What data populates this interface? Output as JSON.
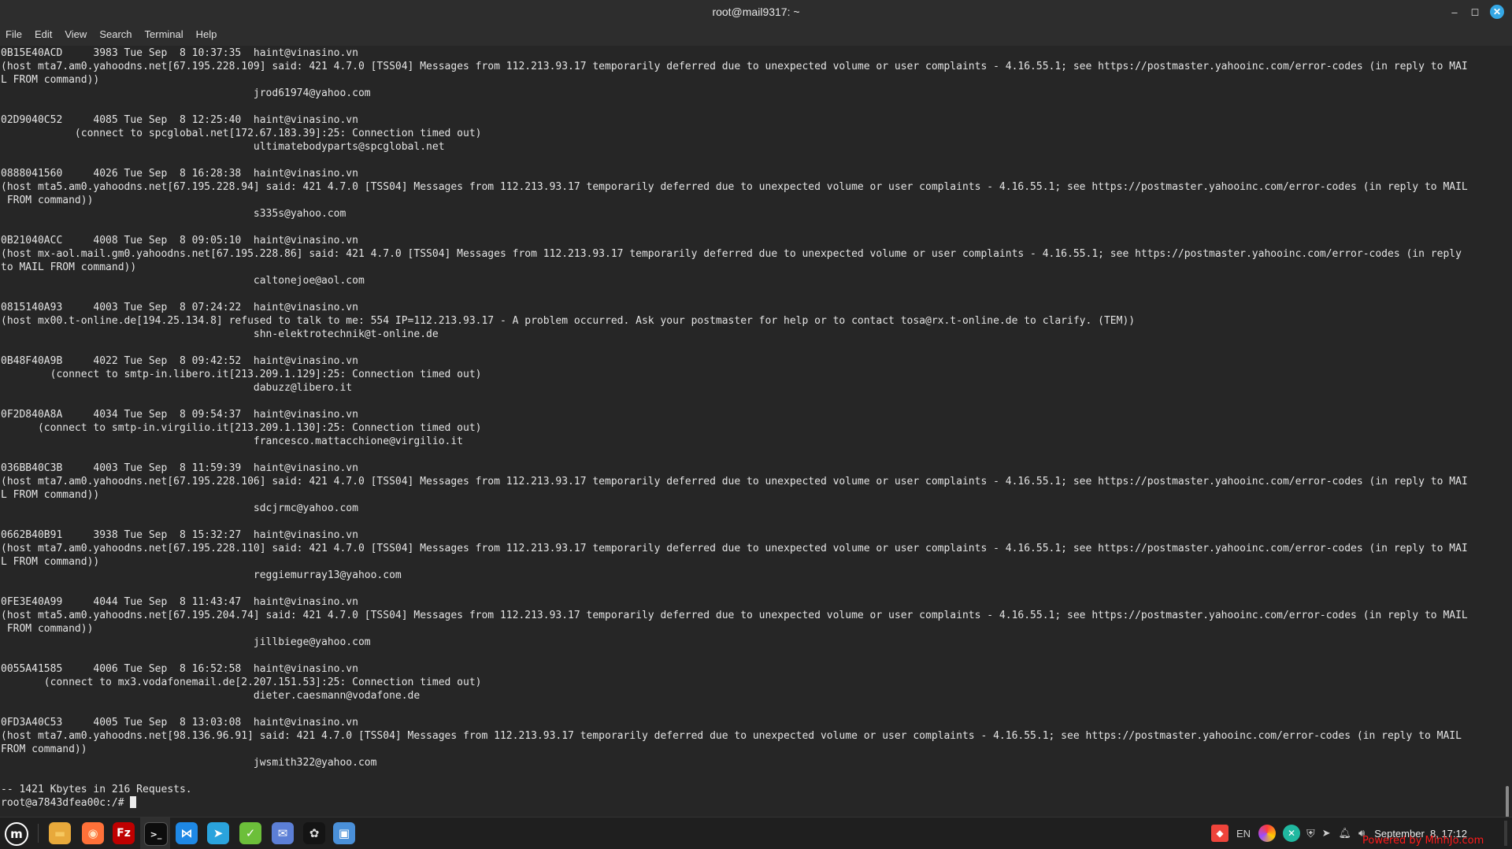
{
  "window": {
    "title": "root@mail9317: ~",
    "minimize_glyph": "–",
    "maximize_glyph": "◻",
    "close_glyph": "✕"
  },
  "menubar": {
    "items": [
      "File",
      "Edit",
      "View",
      "Search",
      "Terminal",
      "Help"
    ]
  },
  "terminal": {
    "lines": [
      "0B15E40ACD     3983 Tue Sep  8 10:37:35  haint@vinasino.vn",
      "(host mta7.am0.yahoodns.net[67.195.228.109] said: 421 4.7.0 [TSS04] Messages from 112.213.93.17 temporarily deferred due to unexpected volume or user complaints - 4.16.55.1; see https://postmaster.yahooinc.com/error-codes (in reply to MAI",
      "L FROM command))",
      "                                         jrod61974@yahoo.com",
      "",
      "02D9040C52     4085 Tue Sep  8 12:25:40  haint@vinasino.vn",
      "            (connect to spcglobal.net[172.67.183.39]:25: Connection timed out)",
      "                                         ultimatebodyparts@spcglobal.net",
      "",
      "0888041560     4026 Tue Sep  8 16:28:38  haint@vinasino.vn",
      "(host mta5.am0.yahoodns.net[67.195.228.94] said: 421 4.7.0 [TSS04] Messages from 112.213.93.17 temporarily deferred due to unexpected volume or user complaints - 4.16.55.1; see https://postmaster.yahooinc.com/error-codes (in reply to MAIL",
      " FROM command))",
      "                                         s335s@yahoo.com",
      "",
      "0B21040ACC     4008 Tue Sep  8 09:05:10  haint@vinasino.vn",
      "(host mx-aol.mail.gm0.yahoodns.net[67.195.228.86] said: 421 4.7.0 [TSS04] Messages from 112.213.93.17 temporarily deferred due to unexpected volume or user complaints - 4.16.55.1; see https://postmaster.yahooinc.com/error-codes (in reply",
      "to MAIL FROM command))",
      "                                         caltonejoe@aol.com",
      "",
      "0815140A93     4003 Tue Sep  8 07:24:22  haint@vinasino.vn",
      "(host mx00.t-online.de[194.25.134.8] refused to talk to me: 554 IP=112.213.93.17 - A problem occurred. Ask your postmaster for help or to contact tosa@rx.t-online.de to clarify. (TEM))",
      "                                         shn-elektrotechnik@t-online.de",
      "",
      "0B48F40A9B     4022 Tue Sep  8 09:42:52  haint@vinasino.vn",
      "        (connect to smtp-in.libero.it[213.209.1.129]:25: Connection timed out)",
      "                                         dabuzz@libero.it",
      "",
      "0F2D840A8A     4034 Tue Sep  8 09:54:37  haint@vinasino.vn",
      "      (connect to smtp-in.virgilio.it[213.209.1.130]:25: Connection timed out)",
      "                                         francesco.mattacchione@virgilio.it",
      "",
      "036BB40C3B     4003 Tue Sep  8 11:59:39  haint@vinasino.vn",
      "(host mta7.am0.yahoodns.net[67.195.228.106] said: 421 4.7.0 [TSS04] Messages from 112.213.93.17 temporarily deferred due to unexpected volume or user complaints - 4.16.55.1; see https://postmaster.yahooinc.com/error-codes (in reply to MAI",
      "L FROM command))",
      "                                         sdcjrmc@yahoo.com",
      "",
      "0662B40B91     3938 Tue Sep  8 15:32:27  haint@vinasino.vn",
      "(host mta7.am0.yahoodns.net[67.195.228.110] said: 421 4.7.0 [TSS04] Messages from 112.213.93.17 temporarily deferred due to unexpected volume or user complaints - 4.16.55.1; see https://postmaster.yahooinc.com/error-codes (in reply to MAI",
      "L FROM command))",
      "                                         reggiemurray13@yahoo.com",
      "",
      "0FE3E40A99     4044 Tue Sep  8 11:43:47  haint@vinasino.vn",
      "(host mta5.am0.yahoodns.net[67.195.204.74] said: 421 4.7.0 [TSS04] Messages from 112.213.93.17 temporarily deferred due to unexpected volume or user complaints - 4.16.55.1; see https://postmaster.yahooinc.com/error-codes (in reply to MAIL",
      " FROM command))",
      "                                         jillbiege@yahoo.com",
      "",
      "0055A41585     4006 Tue Sep  8 16:52:58  haint@vinasino.vn",
      "       (connect to mx3.vodafonemail.de[2.207.151.53]:25: Connection timed out)",
      "                                         dieter.caesmann@vodafone.de",
      "",
      "0FD3A40C53     4005 Tue Sep  8 13:03:08  haint@vinasino.vn",
      "(host mta7.am0.yahoodns.net[98.136.96.91] said: 421 4.7.0 [TSS04] Messages from 112.213.93.17 temporarily deferred due to unexpected volume or user complaints - 4.16.55.1; see https://postmaster.yahooinc.com/error-codes (in reply to MAIL",
      "FROM command))",
      "                                         jwsmith322@yahoo.com",
      "",
      "-- 1421 Kbytes in 216 Requests."
    ],
    "prompt": "root@a7843dfea00c:/# "
  },
  "taskbar": {
    "apps": [
      {
        "name": "mint-menu-icon",
        "glyph": "m",
        "bg": "#1f1f1f",
        "fg": "#ffffff"
      },
      {
        "name": "files-icon",
        "glyph": "▬",
        "bg": "#e8a93b",
        "fg": "#f6c860"
      },
      {
        "name": "firefox-icon",
        "glyph": "◉",
        "bg": "#ff7139",
        "fg": "#ffe3c2"
      },
      {
        "name": "filezilla-icon",
        "glyph": "Fz",
        "bg": "#bf0000",
        "fg": "#ffffff"
      },
      {
        "name": "terminal-icon",
        "glyph": ">_",
        "bg": "#0d0d0d",
        "fg": "#ffffff"
      },
      {
        "name": "vscode-icon",
        "glyph": "⋈",
        "bg": "#1e88e5",
        "fg": "#ffffff"
      },
      {
        "name": "telegram-icon",
        "glyph": "➤",
        "bg": "#2aa3dd",
        "fg": "#ffffff"
      },
      {
        "name": "update-manager-icon",
        "glyph": "✓",
        "bg": "#6cbf3a",
        "fg": "#ffffff"
      },
      {
        "name": "mail-icon",
        "glyph": "✉",
        "bg": "#5c7fd6",
        "fg": "#ffffff"
      },
      {
        "name": "chatgpt-icon",
        "glyph": "✿",
        "bg": "#141414",
        "fg": "#dcdcdc"
      },
      {
        "name": "rss-reader-icon",
        "glyph": "▣",
        "bg": "#4a90d9",
        "fg": "#ffffff"
      }
    ],
    "tray": {
      "anydesk_glyph": "◆",
      "language": "EN",
      "clock": "September  8, 17:12"
    },
    "watermark": "Powered by MinhJo.com"
  },
  "colors": {
    "terminal_bg": "#262626",
    "terminal_fg": "#e4e4e4",
    "titlebar_bg": "#2d2d2d",
    "taskbar_bg": "#1f1f1f",
    "close_accent": "#35a8e6"
  }
}
